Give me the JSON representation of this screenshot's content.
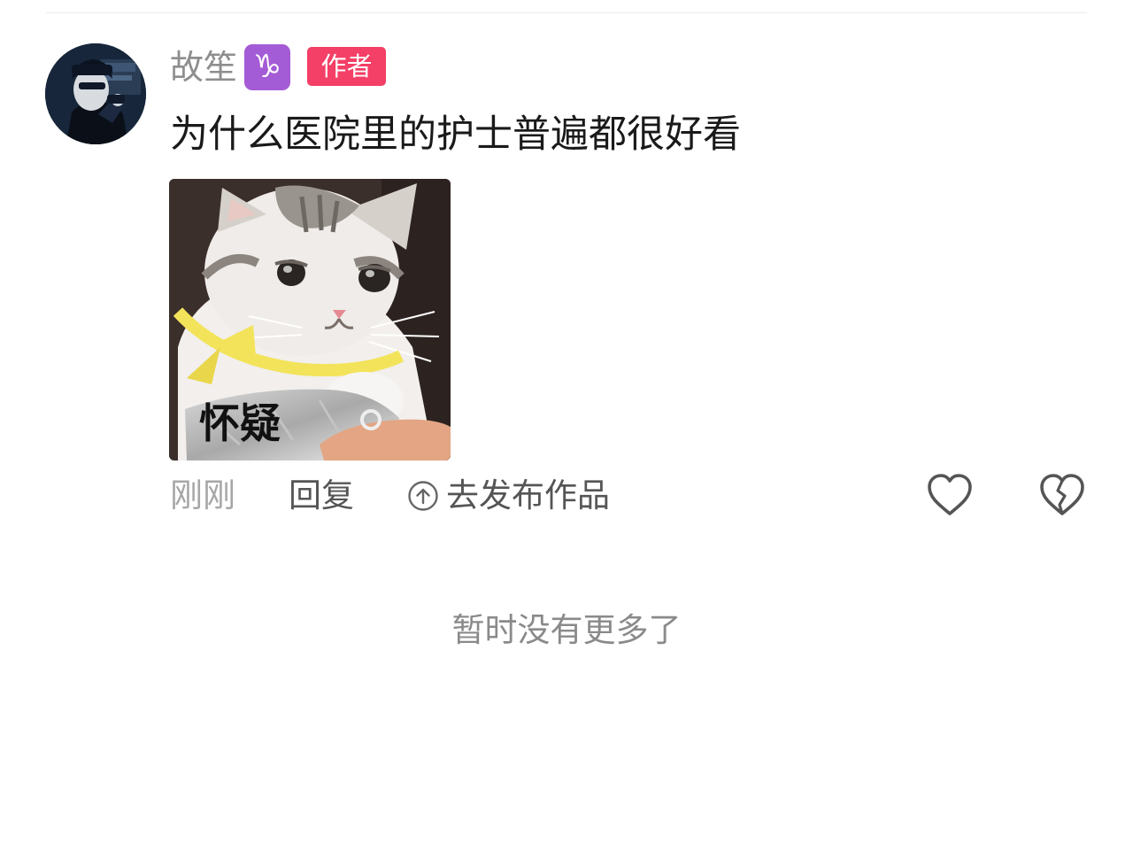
{
  "comment": {
    "username": "故笙",
    "zodiac_symbol": "♑",
    "author_badge": "作者",
    "text": "为什么医院里的护士普遍都很好看",
    "sticker_caption": "怀疑",
    "time": "刚刚",
    "reply_label": "回复",
    "publish_label": "去发布作品"
  },
  "footer": {
    "end_text": "暂时没有更多了"
  },
  "icons": {
    "zodiac": "capricorn-icon",
    "publish": "arrow-up-circle-icon",
    "like": "heart-outline-icon",
    "dislike": "broken-heart-icon"
  },
  "colors": {
    "author_badge": "#f43f66",
    "zodiac_badge": "#a45bd6",
    "username": "#8e8e8e",
    "muted_text": "#a6a6a6"
  }
}
